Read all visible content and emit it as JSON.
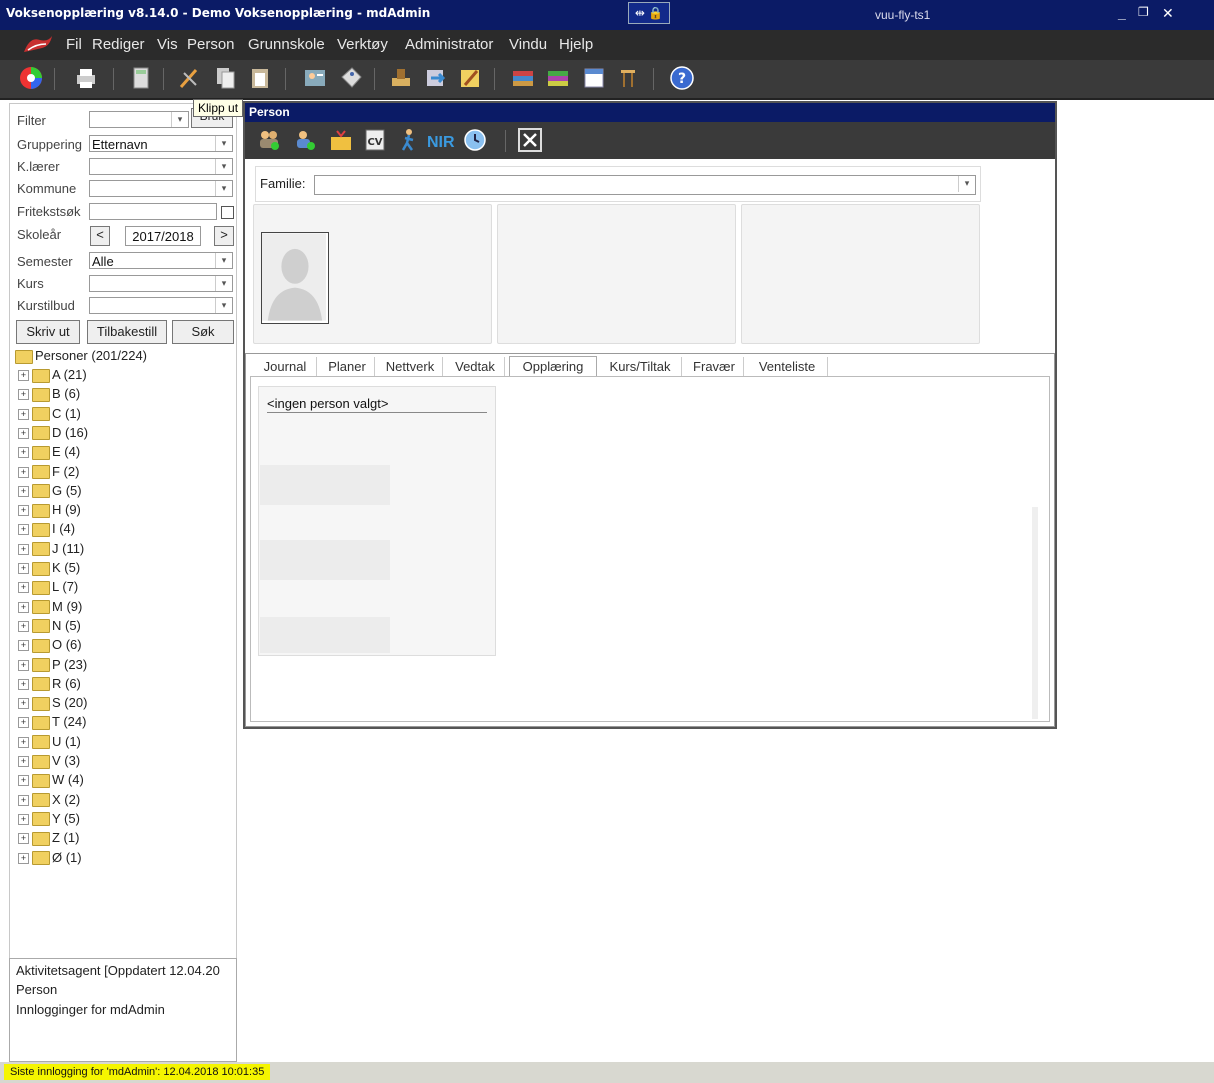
{
  "titlebar": {
    "title": "Voksenopplæring v8.14.0 - Demo Voksenopplæring - mdAdmin",
    "host": "vuu-fly-ts1",
    "minimize": "_",
    "restore": "❐",
    "close": "✕"
  },
  "menu": {
    "items": [
      "Fil",
      "Rediger",
      "Vis",
      "Person",
      "Grunnskole",
      "Verktøy",
      "Administrator",
      "Vindu",
      "Hjelp"
    ]
  },
  "toolbar": {
    "tooltip": "Klipp ut"
  },
  "filter": {
    "filter_label": "Filter",
    "apply_label": "Bruk",
    "grouping_label": "Gruppering",
    "grouping_value": "Etternavn",
    "teacher_label": "K.lærer",
    "municipality_label": "Kommune",
    "freetext_label": "Fritekstsøk",
    "schoolyear_label": "Skoleår",
    "schoolyear_value": "2017/2018",
    "prev": "<",
    "next": ">",
    "semester_label": "Semester",
    "semester_value": "Alle",
    "course_label": "Kurs",
    "courseoffer_label": "Kurstilbud",
    "print_button": "Skriv ut",
    "reset_button": "Tilbakestill",
    "search_button": "Søk"
  },
  "tree": {
    "root": "Personer  (201/224)",
    "items": [
      "A  (21)",
      "B  (6)",
      "C  (1)",
      "D  (16)",
      "E  (4)",
      "F  (2)",
      "G  (5)",
      "H  (9)",
      "I  (4)",
      "J  (11)",
      "K  (5)",
      "L  (7)",
      "M  (9)",
      "N  (5)",
      "O  (6)",
      "P  (23)",
      "R  (6)",
      "S  (20)",
      "T  (24)",
      "U  (1)",
      "V  (3)",
      "W  (4)",
      "X  (2)",
      "Y  (5)",
      "Z  (1)",
      "Ø  (1)"
    ]
  },
  "activity": {
    "line1": "Aktivitetsagent [Oppdatert 12.04.20",
    "line2": "Person",
    "line3": "Innlogginger for mdAdmin"
  },
  "person": {
    "title": "Person",
    "nir_label": "NIR",
    "family_label": "Familie:",
    "tabs": [
      "Journal",
      "Planer",
      "Nettverk",
      "Vedtak",
      "Opplæring",
      "Kurs/Tiltak",
      "Fravær",
      "Venteliste"
    ],
    "active_tab": "Opplæring",
    "no_person": "<ingen person valgt>"
  },
  "status": {
    "text": "Siste innlogging for 'mdAdmin': 12.04.2018 10:01:35"
  }
}
